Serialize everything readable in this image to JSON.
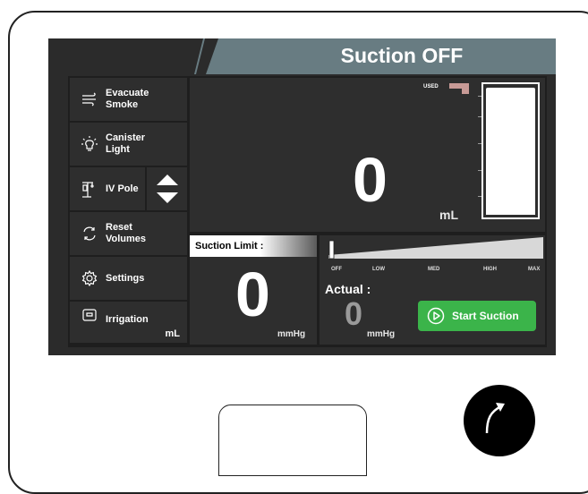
{
  "header": {
    "title": "Suction OFF"
  },
  "sidebar": {
    "items": [
      {
        "label_line1": "Evacuate",
        "label_line2": "Smoke",
        "icon": "smoke-icon"
      },
      {
        "label_line1": "Canister",
        "label_line2": "Light",
        "icon": "lightbulb-icon"
      },
      {
        "label_line1": "IV Pole",
        "label_line2": "",
        "icon": "iv-pole-icon"
      },
      {
        "label_line1": "Reset",
        "label_line2": "Volumes",
        "icon": "reset-icon"
      },
      {
        "label_line1": "Settings",
        "label_line2": "",
        "icon": "gear-icon"
      },
      {
        "label_line1": "Irrigation",
        "label_line2": "",
        "icon": "irrigation-icon"
      }
    ],
    "irrigation_unit": "mL"
  },
  "volume": {
    "value": "0",
    "unit": "mL",
    "used_label": "USED"
  },
  "suction_limit": {
    "label": "Suction Limit :",
    "value": "0",
    "unit": "mmHg"
  },
  "slider": {
    "labels": [
      "OFF",
      "LOW",
      "MED",
      "HIGH",
      "MAX"
    ],
    "level": 0
  },
  "actual": {
    "label": "Actual :",
    "value": "0",
    "unit": "mmHg"
  },
  "start_button": {
    "label": "Start Suction"
  },
  "colors": {
    "header": "#687c82",
    "start_button": "#3bb44a",
    "used_marker": "#c89a96"
  }
}
